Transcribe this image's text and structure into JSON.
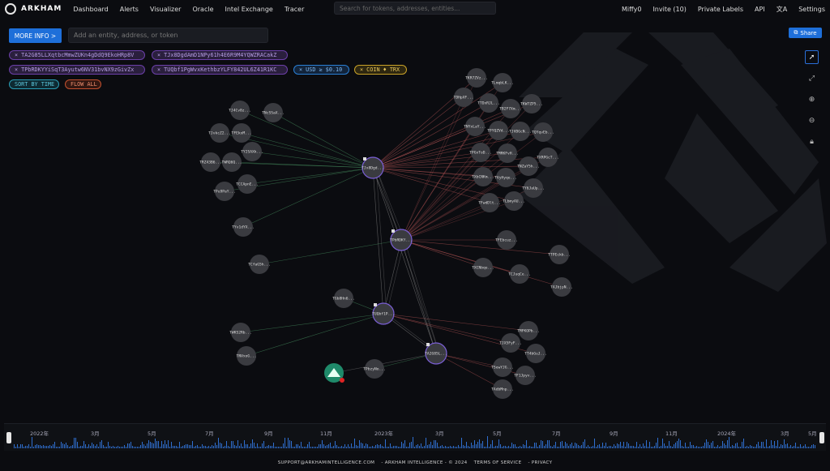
{
  "nav": {
    "brand": "ARKHAM",
    "links": [
      "Dashboard",
      "Alerts",
      "Visualizer",
      "Oracle",
      "Intel Exchange",
      "Tracer"
    ],
    "search_placeholder": "Search for tokens, addresses, entities...",
    "user": "Miffy0",
    "invite": "Invite (10)",
    "private_labels": "Private Labels",
    "api": "API",
    "settings": "Settings"
  },
  "toolbar": {
    "more_info": "MORE INFO >",
    "add_placeholder": "Add an entity, address, or token",
    "share": "Share"
  },
  "filters": {
    "addresses": [
      "× TA2G85LLXqtbcMmwZUKn4gDdQ9EkoHRp8V",
      "× TJx8DgdAmD1NPy61h4E6R9M4YQWZRACakZ",
      "× TPbRDKYYiSqT3Ayutw6NV31bvNX9zGivZx",
      "× TUQbf1PgWvxKethbzYLFY842UL6Z41R1KC"
    ],
    "usd": "× USD ≥ $0.10",
    "coin": "× COIN ♦ TRX",
    "sort": "SORT BY TIME",
    "flow": "FLOW ALL"
  },
  "graph": {
    "hub_labels": [
      "TJx8Dgd...",
      "TPbRDKY...",
      "TUQbf1P...",
      "TA2G85L..."
    ],
    "node_labels": [
      "TJ4Cv8z...",
      "TNcSSaX...",
      "TJvkcZ2...",
      "TFEkxM...",
      "TRZ43B6...",
      "TWRQ6Q...",
      "TY2SAXk...",
      "TCCApnE...",
      "TPu9PaY...",
      "TYv1dYX...",
      "TCfaG5h...",
      "TGb8Hn6...",
      "TWKS2Rb...",
      "TNVxoG...",
      "TPbzyNo...",
      "TKR7ZVz...",
      "TLmqbLK...",
      "TDHpXF...",
      "TTDxRJL...",
      "TB2F7Xm...",
      "TKW7ZP5...",
      "TNYxLaY...",
      "TPYQZVd...",
      "TJVDGcN...",
      "TQYqvEb...",
      "TPGxToD...",
      "TMRKFvH...",
      "TNZaY5h...",
      "TXRPGcT...",
      "TXbCNKm...",
      "TVyHyqe...",
      "TY6JaUp...",
      "TFwdDlt...",
      "TLbmyAU...",
      "TFEbcuz...",
      "TTPEckb...",
      "TXCNbqe...",
      "TCJuqCe...",
      "TAJbjpN...",
      "TMFKOPb...",
      "TJX5FyF...",
      "TT4bGuJ...",
      "TSewYJG...",
      "TF1Jpyv...",
      "TAdbMnp..."
    ],
    "wallet_icon": "exchange-logo-icon"
  },
  "timeline": {
    "labels": [
      "2022年",
      "3月",
      "5月",
      "7月",
      "9月",
      "11月",
      "2023年",
      "3月",
      "5月",
      "7月",
      "9月",
      "11月",
      "2024年",
      "3月",
      "5月"
    ]
  },
  "footer": {
    "email": "SUPPORT@ARKHAMINTELLIGENCE.COM",
    "copyright": "- ARKHAM INTELLIGENCE - © 2024",
    "terms": "TERMS OF SERVICE",
    "privacy": "- PRIVACY"
  },
  "colors": {
    "accent": "#1e6fd9",
    "hub_border": "#7b5fd6",
    "edge_red": "#c25a5a",
    "edge_green": "#4fa36b",
    "edge_gray": "#8a8a8a"
  }
}
